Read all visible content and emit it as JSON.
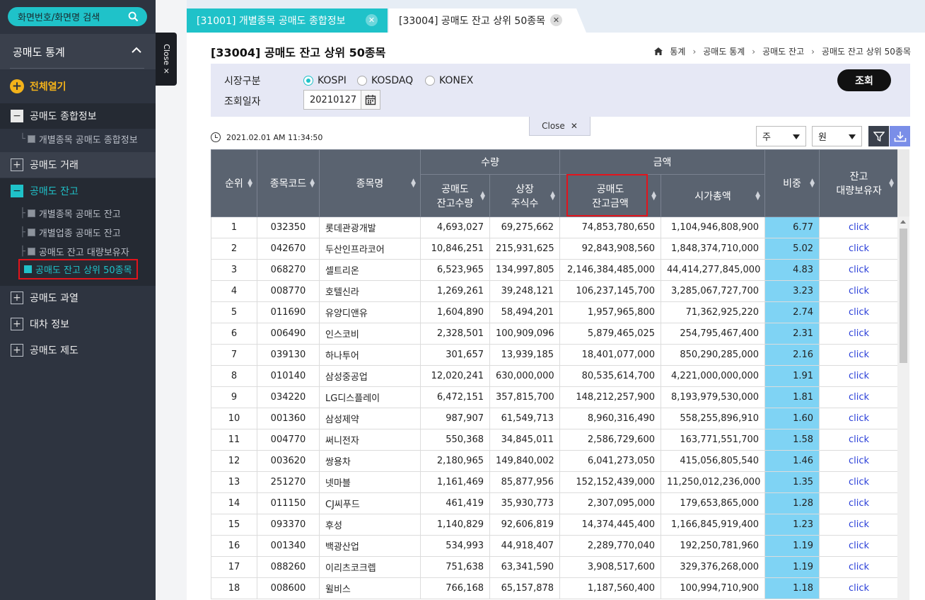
{
  "search": {
    "label": "화면번호/화면명 검색"
  },
  "sidebar": {
    "section_title": "공매도 통계",
    "close_label": "Close ×",
    "expand_all": "전체열기",
    "groups": [
      {
        "label": "공매도 종합정보"
      },
      {
        "label": "공매도 거래"
      },
      {
        "label": "공매도 잔고"
      },
      {
        "label": "공매도 과열"
      },
      {
        "label": "대차 정보"
      },
      {
        "label": "공매도 제도"
      }
    ],
    "subs": [
      {
        "label": "개별종목 공매도 종합정보"
      },
      {
        "label": "개별종목 공매도 잔고"
      },
      {
        "label": "개별업종 공매도 잔고"
      },
      {
        "label": "공매도 잔고 대량보유자"
      },
      {
        "label": "공매도 잔고 상위 50종목"
      }
    ]
  },
  "tabs": [
    {
      "label": "[31001] 개별종목 공매도 종합정보"
    },
    {
      "label": "[33004] 공매도 잔고 상위 50종목"
    }
  ],
  "page": {
    "title": "[33004] 공매도 잔고 상위 50종목",
    "breadcrumb": [
      "통계",
      "공매도 통계",
      "공매도 잔고",
      "공매도 잔고 상위 50종목"
    ]
  },
  "filter": {
    "market_label": "시장구분",
    "markets": [
      "KOSPI",
      "KOSDAQ",
      "KONEX"
    ],
    "selected_market": "KOSPI",
    "date_label": "조회일자",
    "date_value": "20210127",
    "search_button": "조회",
    "close_label": "Close"
  },
  "toolbar": {
    "timestamp": "2021.02.01 AM 11:34:50",
    "period_select": "주",
    "unit_select": "원"
  },
  "table": {
    "headers": {
      "rank": "순위",
      "code": "종목코드",
      "name": "종목명",
      "quantity_group": "수량",
      "amount_group": "금액",
      "short_qty_1": "공매도",
      "short_qty_2": "잔고수량",
      "listed_1": "상장",
      "listed_2": "주식수",
      "short_amt_1": "공매도",
      "short_amt_2": "잔고금액",
      "market_cap": "시가총액",
      "ratio": "비중",
      "holder_1": "잔고",
      "holder_2": "대량보유자"
    },
    "rows": [
      [
        "1",
        "032350",
        "롯데관광개발",
        "4,693,027",
        "69,275,662",
        "74,853,780,650",
        "1,104,946,808,900",
        "6.77",
        "click"
      ],
      [
        "2",
        "042670",
        "두산인프라코어",
        "10,846,251",
        "215,931,625",
        "92,843,908,560",
        "1,848,374,710,000",
        "5.02",
        "click"
      ],
      [
        "3",
        "068270",
        "셀트리온",
        "6,523,965",
        "134,997,805",
        "2,146,384,485,000",
        "44,414,277,845,000",
        "4.83",
        "click"
      ],
      [
        "4",
        "008770",
        "호텔신라",
        "1,269,261",
        "39,248,121",
        "106,237,145,700",
        "3,285,067,727,700",
        "3.23",
        "click"
      ],
      [
        "5",
        "011690",
        "유양디앤유",
        "1,604,890",
        "58,494,201",
        "1,957,965,800",
        "71,362,925,220",
        "2.74",
        "click"
      ],
      [
        "6",
        "006490",
        "인스코비",
        "2,328,501",
        "100,909,096",
        "5,879,465,025",
        "254,795,467,400",
        "2.31",
        "click"
      ],
      [
        "7",
        "039130",
        "하나투어",
        "301,657",
        "13,939,185",
        "18,401,077,000",
        "850,290,285,000",
        "2.16",
        "click"
      ],
      [
        "8",
        "010140",
        "삼성중공업",
        "12,020,241",
        "630,000,000",
        "80,535,614,700",
        "4,221,000,000,000",
        "1.91",
        "click"
      ],
      [
        "9",
        "034220",
        "LG디스플레이",
        "6,472,151",
        "357,815,700",
        "148,212,257,900",
        "8,193,979,530,000",
        "1.81",
        "click"
      ],
      [
        "10",
        "001360",
        "삼성제약",
        "987,907",
        "61,549,713",
        "8,960,316,490",
        "558,255,896,910",
        "1.60",
        "click"
      ],
      [
        "11",
        "004770",
        "써니전자",
        "550,368",
        "34,845,011",
        "2,586,729,600",
        "163,771,551,700",
        "1.58",
        "click"
      ],
      [
        "12",
        "003620",
        "쌍용차",
        "2,180,965",
        "149,840,002",
        "6,041,273,050",
        "415,056,805,540",
        "1.46",
        "click"
      ],
      [
        "13",
        "251270",
        "넷마블",
        "1,161,469",
        "85,877,956",
        "152,152,439,000",
        "11,250,012,236,000",
        "1.35",
        "click"
      ],
      [
        "14",
        "011150",
        "CJ씨푸드",
        "461,419",
        "35,930,773",
        "2,307,095,000",
        "179,653,865,000",
        "1.28",
        "click"
      ],
      [
        "15",
        "093370",
        "후성",
        "1,140,829",
        "92,606,819",
        "14,374,445,400",
        "1,166,845,919,400",
        "1.23",
        "click"
      ],
      [
        "16",
        "001340",
        "백광산업",
        "534,993",
        "44,918,407",
        "2,289,770,040",
        "192,250,781,960",
        "1.19",
        "click"
      ],
      [
        "17",
        "088260",
        "이리츠코크렙",
        "751,638",
        "63,341,590",
        "3,908,517,600",
        "329,376,268,000",
        "1.19",
        "click"
      ],
      [
        "18",
        "008600",
        "윌비스",
        "766,168",
        "65,157,878",
        "1,187,560,400",
        "100,994,710,900",
        "1.18",
        "click"
      ]
    ]
  }
}
